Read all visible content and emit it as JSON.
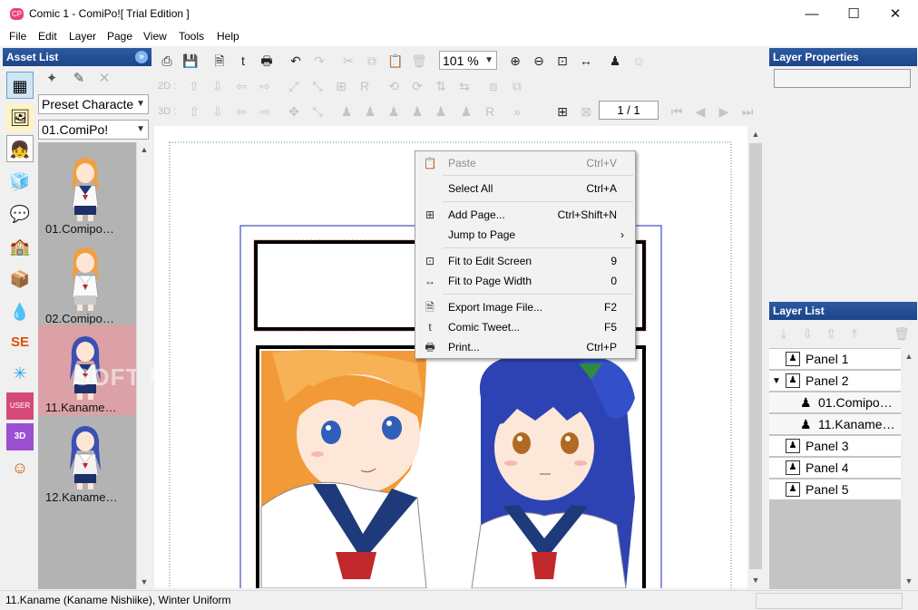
{
  "window": {
    "title": "Comic 1 - ComiPo![ Trial Edition ]",
    "app_icon": "comipo-logo-icon",
    "minimize": "—",
    "maximize": "☐",
    "close": "✕"
  },
  "menu": [
    "File",
    "Edit",
    "Layer",
    "Page",
    "View",
    "Tools",
    "Help"
  ],
  "asset_list": {
    "title": "Asset List",
    "collapse_glyph": "»",
    "preset_select": "Preset Characte",
    "character_select": "01.ComiPo!",
    "tabs": [
      {
        "icon": "panel-layout-icon",
        "glyph": "▦"
      },
      {
        "icon": "background-image-icon",
        "glyph": "🖼"
      },
      {
        "icon": "character-icon",
        "glyph": "👧"
      },
      {
        "icon": "3d-object-icon",
        "glyph": "🧊"
      },
      {
        "icon": "speech-balloon-icon",
        "glyph": "💬"
      },
      {
        "icon": "background-scene-icon",
        "glyph": "🏫"
      },
      {
        "icon": "item-icon",
        "glyph": "📦"
      },
      {
        "icon": "effect-drop-icon",
        "glyph": "💧"
      },
      {
        "icon": "sound-effect-icon",
        "glyph": "SE"
      },
      {
        "icon": "image-effect-icon",
        "glyph": "✳"
      },
      {
        "icon": "user-image-icon",
        "glyph": "USER"
      },
      {
        "icon": "user-3d-icon",
        "glyph": "3D"
      },
      {
        "icon": "character-face-icon",
        "glyph": "☺"
      }
    ],
    "items": [
      "01.Comipo…",
      "02.Comipo…",
      "11.Kaname…",
      "12.Kaname…"
    ],
    "watermark": "SOFTPEDIA"
  },
  "toolbar": {
    "zoom": "101 %",
    "row_2d_label": "2D :",
    "row_3d_label": "3D :",
    "page": "1 / 1"
  },
  "context_menu": [
    {
      "label": "Paste",
      "shortcut": "Ctrl+V",
      "icon": "paste-icon",
      "disabled": true
    },
    {
      "label": "Select All",
      "shortcut": "Ctrl+A"
    },
    {
      "label": "Add Page...",
      "shortcut": "Ctrl+Shift+N",
      "icon": "add-page-icon"
    },
    {
      "label": "Jump to Page",
      "shortcut": "›"
    },
    {
      "label": "Fit to Edit Screen",
      "shortcut": "9",
      "icon": "fit-screen-icon"
    },
    {
      "label": "Fit to Page Width",
      "shortcut": "0",
      "icon": "fit-width-icon"
    },
    {
      "label": "Export Image File...",
      "shortcut": "F2",
      "icon": "export-image-icon"
    },
    {
      "label": "Comic Tweet...",
      "shortcut": "F5",
      "icon": "tweet-icon"
    },
    {
      "label": "Print...",
      "shortcut": "Ctrl+P",
      "icon": "print-icon"
    }
  ],
  "layer_properties": {
    "title": "Layer Properties"
  },
  "layer_list": {
    "title": "Layer List",
    "rows": [
      {
        "label": "Panel 1",
        "level": 0
      },
      {
        "label": "Panel 2",
        "level": 0,
        "expanded": true
      },
      {
        "label": "01.Comipo…",
        "level": 1
      },
      {
        "label": "11.Kaname…",
        "level": 1
      },
      {
        "label": "Panel 3",
        "level": 0
      },
      {
        "label": "Panel 4",
        "level": 0
      },
      {
        "label": "Panel 5",
        "level": 0
      }
    ]
  },
  "status": "11.Kaname (Kaname Nishiike), Winter Uniform"
}
